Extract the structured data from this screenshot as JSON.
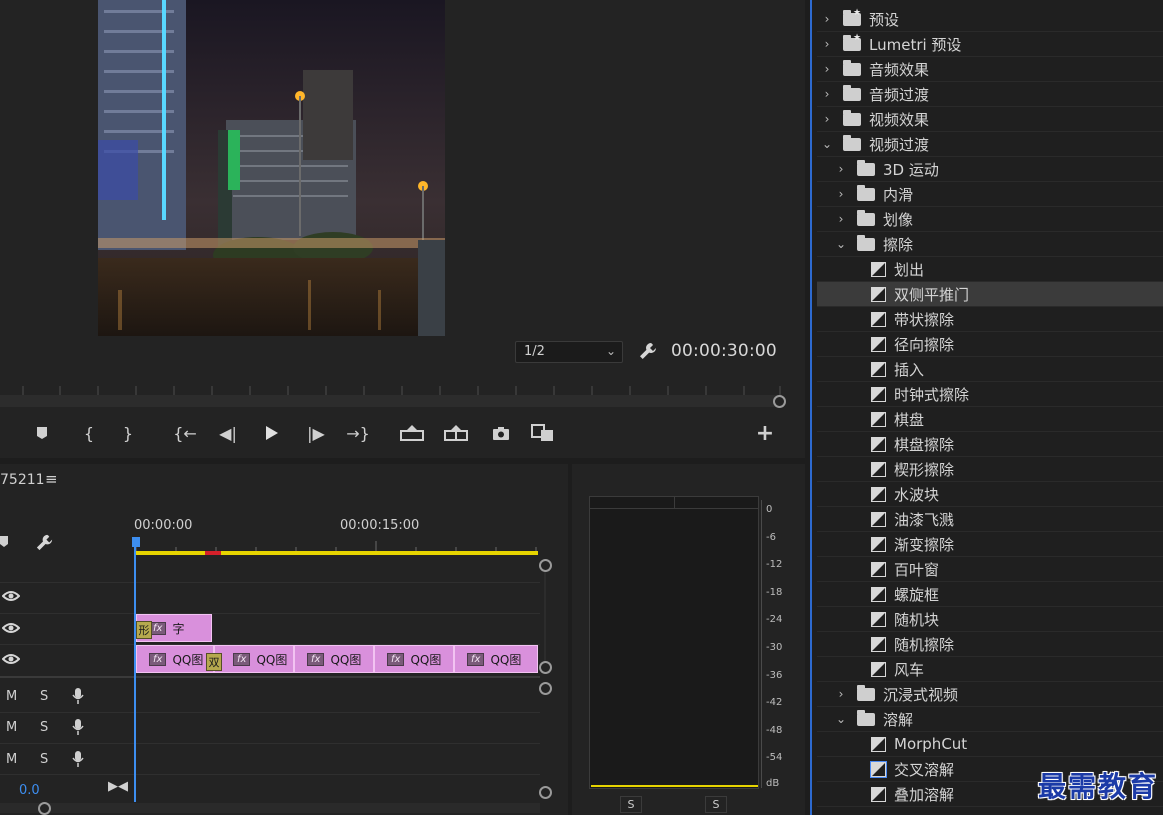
{
  "monitor": {
    "zoom_value": "1/2",
    "timecode": "00:00:30:00"
  },
  "transport": {
    "icons": [
      "add-marker-icon",
      "mark-in-icon",
      "mark-out-icon",
      "go-to-in-icon",
      "step-back-icon",
      "play-icon",
      "step-forward-icon",
      "go-to-out-icon",
      "lift-icon",
      "extract-icon",
      "export-frame-icon",
      "comparison-view-icon",
      "add-button-icon"
    ]
  },
  "timeline": {
    "sequence_name": "75211",
    "ruler": [
      "00:00:00",
      "00:00:15:00"
    ],
    "clips": {
      "v3_label": "字",
      "v2_label_a": "QQ图",
      "v2_label_b": "QQ图",
      "v2_label_c": "QQ图",
      "v2_label_d": "QQ图",
      "v2_label_e": "QQ图",
      "transition_label": "双",
      "v3_edge_label": "形"
    },
    "audio_tracks": [
      {
        "m": "M",
        "s": "S"
      },
      {
        "m": "M",
        "s": "S"
      },
      {
        "m": "M",
        "s": "S"
      }
    ],
    "master_level": "0.0"
  },
  "meter": {
    "db_labels": [
      "0",
      "-6",
      "-12",
      "-18",
      "-24",
      "-30",
      "-36",
      "-42",
      "-48",
      "-54",
      "dB"
    ],
    "solo_left": "S",
    "solo_right": "S"
  },
  "effects": {
    "items": [
      {
        "label": "预设",
        "kind": "folder-star",
        "level": 0,
        "arrow": "›"
      },
      {
        "label": "Lumetri 预设",
        "kind": "folder-star",
        "level": 0,
        "arrow": "›"
      },
      {
        "label": "音频效果",
        "kind": "folder",
        "level": 0,
        "arrow": "›"
      },
      {
        "label": "音频过渡",
        "kind": "folder",
        "level": 0,
        "arrow": "›"
      },
      {
        "label": "视频效果",
        "kind": "folder",
        "level": 0,
        "arrow": "›"
      },
      {
        "label": "视频过渡",
        "kind": "folder",
        "level": 0,
        "arrow": "⌄"
      },
      {
        "label": "3D 运动",
        "kind": "folder",
        "level": 1,
        "arrow": "›"
      },
      {
        "label": "内滑",
        "kind": "folder",
        "level": 1,
        "arrow": "›"
      },
      {
        "label": "划像",
        "kind": "folder",
        "level": 1,
        "arrow": "›"
      },
      {
        "label": "擦除",
        "kind": "folder",
        "level": 1,
        "arrow": "⌄"
      },
      {
        "label": "划出",
        "kind": "item",
        "level": 2
      },
      {
        "label": "双侧平推门",
        "kind": "item",
        "level": 2,
        "selected": true
      },
      {
        "label": "带状擦除",
        "kind": "item",
        "level": 2
      },
      {
        "label": "径向擦除",
        "kind": "item",
        "level": 2
      },
      {
        "label": "插入",
        "kind": "item",
        "level": 2
      },
      {
        "label": "时钟式擦除",
        "kind": "item",
        "level": 2
      },
      {
        "label": "棋盘",
        "kind": "item",
        "level": 2
      },
      {
        "label": "棋盘擦除",
        "kind": "item",
        "level": 2
      },
      {
        "label": "楔形擦除",
        "kind": "item",
        "level": 2
      },
      {
        "label": "水波块",
        "kind": "item",
        "level": 2
      },
      {
        "label": "油漆飞溅",
        "kind": "item",
        "level": 2
      },
      {
        "label": "渐变擦除",
        "kind": "item",
        "level": 2
      },
      {
        "label": "百叶窗",
        "kind": "item",
        "level": 2
      },
      {
        "label": "螺旋框",
        "kind": "item",
        "level": 2
      },
      {
        "label": "随机块",
        "kind": "item",
        "level": 2
      },
      {
        "label": "随机擦除",
        "kind": "item",
        "level": 2
      },
      {
        "label": "风车",
        "kind": "item",
        "level": 2
      },
      {
        "label": "沉浸式视频",
        "kind": "folder",
        "level": 1,
        "arrow": "›"
      },
      {
        "label": "溶解",
        "kind": "folder",
        "level": 1,
        "arrow": "⌄"
      },
      {
        "label": "MorphCut",
        "kind": "item",
        "level": 2
      },
      {
        "label": "交叉溶解",
        "kind": "item",
        "level": 2,
        "ring": true
      },
      {
        "label": "叠加溶解",
        "kind": "item",
        "level": 2
      }
    ]
  },
  "watermark": "最需教育"
}
